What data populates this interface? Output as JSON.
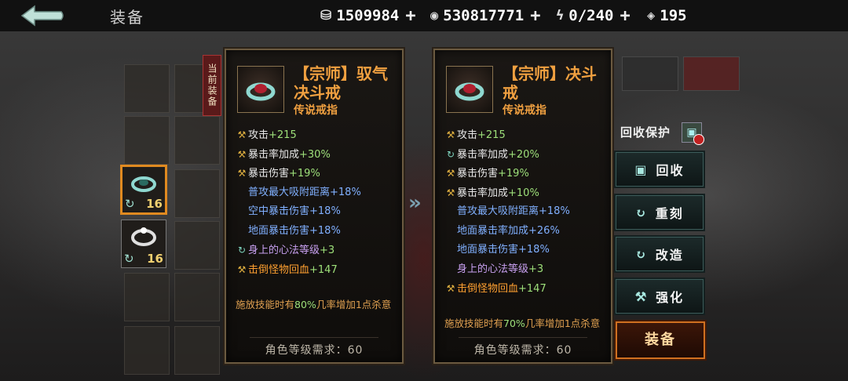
{
  "header": {
    "title": "装备",
    "resources": [
      {
        "icon": "ingot-icon",
        "value": "1509984"
      },
      {
        "icon": "coin-icon",
        "value": "530817771"
      },
      {
        "icon": "lightning-icon",
        "value": "0/240"
      },
      {
        "icon": "ticket-icon",
        "value": "195"
      }
    ]
  },
  "inventory": {
    "current_tag": "当前装备",
    "selected_item": {
      "level": "16"
    },
    "second_item": {
      "level": "16"
    }
  },
  "current_card": {
    "name": "【宗师】驭气决斗戒",
    "subtitle": "传说戒指",
    "stats": [
      {
        "badge": "gold",
        "key": "攻击",
        "value": "+215",
        "style": "gold"
      },
      {
        "badge": "gold",
        "key": "暴击率加成",
        "value": "+30%",
        "style": "gold"
      },
      {
        "badge": "gold",
        "key": "暴击伤害",
        "value": "+19%",
        "style": "gold"
      },
      {
        "badge": "",
        "key": "普攻最大吸附距离",
        "value": "+18%",
        "style": "blue"
      },
      {
        "badge": "",
        "key": "空中暴击伤害",
        "value": "+18%",
        "style": "blue"
      },
      {
        "badge": "",
        "key": "地面暴击伤害",
        "value": "+18%",
        "style": "blue"
      },
      {
        "badge": "cycle",
        "key": "身上的心法等级",
        "value": "+3",
        "style": "purple"
      },
      {
        "badge": "gold",
        "key": "击倒怪物回血",
        "value": "+147",
        "style": "orange"
      }
    ],
    "desc_before": "施放技能时有",
    "desc_pct": "80%",
    "desc_after": "几率增加1点杀意",
    "requirement": "角色等级需求：60"
  },
  "compare_card": {
    "name": "【宗师】决斗戒",
    "subtitle": "传说戒指",
    "stats": [
      {
        "badge": "gold",
        "key": "攻击",
        "value": "+215",
        "style": "gold"
      },
      {
        "badge": "cycle",
        "key": "暴击率加成",
        "value": "+20%",
        "style": "gold"
      },
      {
        "badge": "gold",
        "key": "暴击伤害",
        "value": "+19%",
        "style": "gold"
      },
      {
        "badge": "gold",
        "key": "暴击率加成",
        "value": "+10%",
        "style": "gold"
      },
      {
        "badge": "",
        "key": "普攻最大吸附距离",
        "value": "+18%",
        "style": "blue"
      },
      {
        "badge": "",
        "key": "地面暴击率加成",
        "value": "+26%",
        "style": "blue"
      },
      {
        "badge": "",
        "key": "地面暴击伤害",
        "value": "+18%",
        "style": "blue"
      },
      {
        "badge": "",
        "key": "身上的心法等级",
        "value": "+3",
        "style": "purple"
      },
      {
        "badge": "gold",
        "key": "击倒怪物回血",
        "value": "+147",
        "style": "orange"
      }
    ],
    "desc_before": "施放技能时有",
    "desc_pct": "70%",
    "desc_after": "几率增加1点杀意",
    "requirement": "角色等级需求：60"
  },
  "actions": {
    "protect_label": "回收保护",
    "recycle": "回收",
    "reforge": "重刻",
    "modify": "改造",
    "enhance": "强化",
    "equip": "装备"
  },
  "colors": {
    "name_gold": "#f0a040",
    "stat_green": "#9ee07a",
    "stat_blue": "#80b0ff",
    "equip_orange": "#d07020"
  }
}
